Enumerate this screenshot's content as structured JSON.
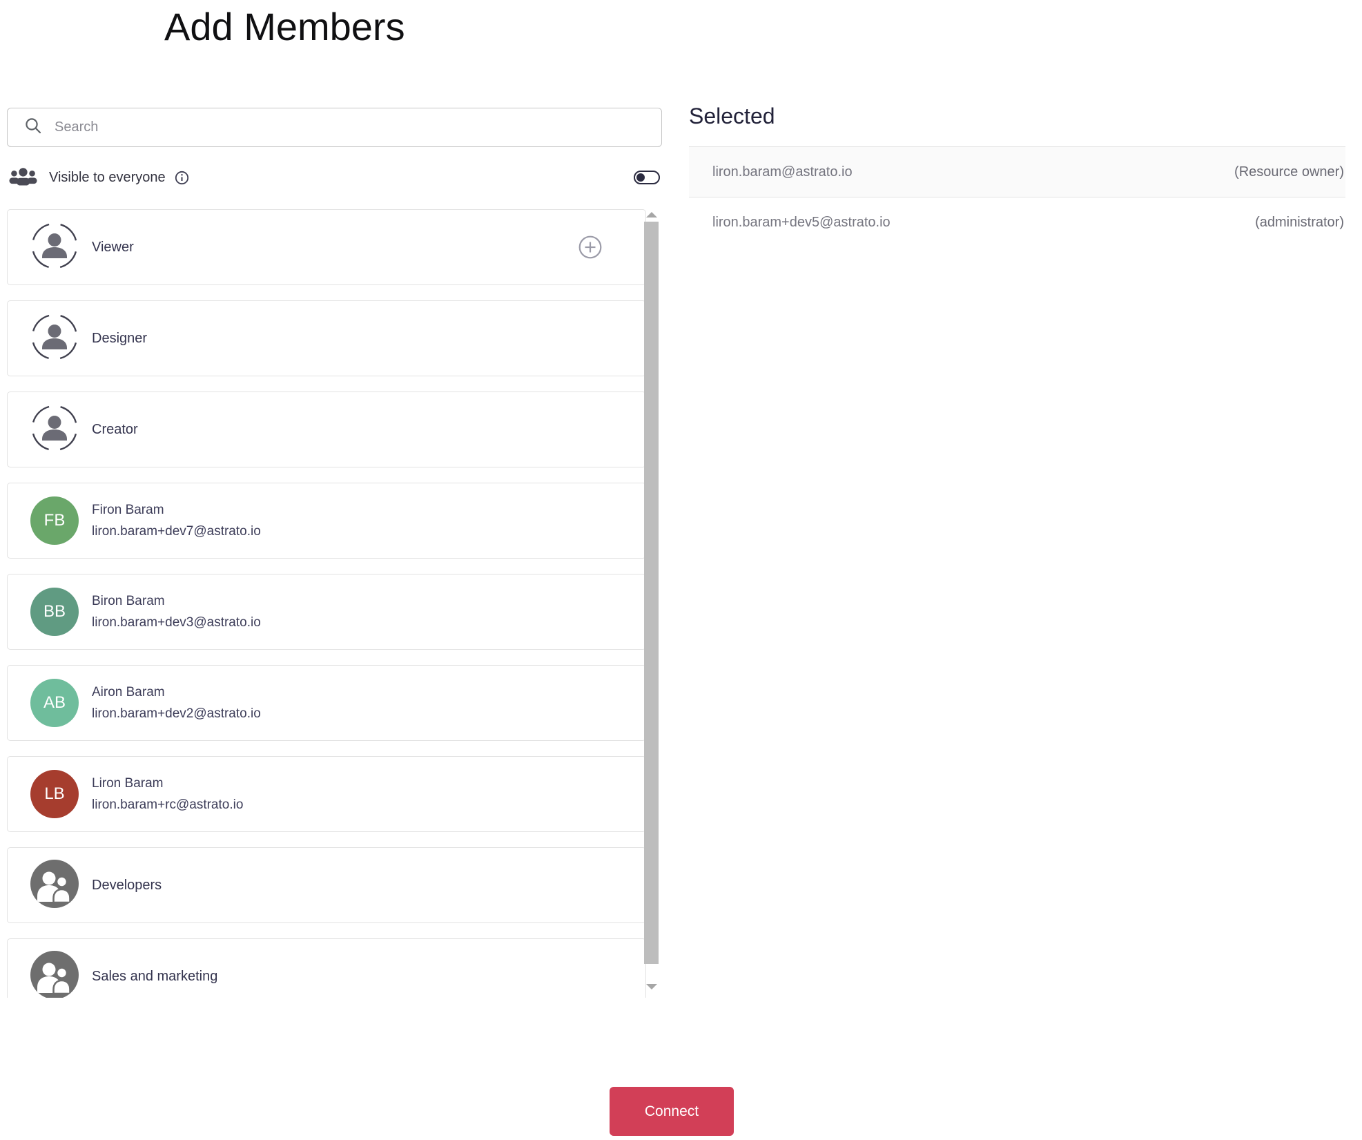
{
  "page": {
    "title": "Add Members"
  },
  "search": {
    "placeholder": "Search",
    "value": ""
  },
  "visibility": {
    "label": "Visible to everyone",
    "toggle_on": false
  },
  "member_list": [
    {
      "type": "role",
      "label": "Viewer",
      "has_add_button": true
    },
    {
      "type": "role",
      "label": "Designer"
    },
    {
      "type": "role",
      "label": "Creator"
    },
    {
      "type": "user",
      "initials": "FB",
      "name": "Firon Baram",
      "email": "liron.baram+dev7@astrato.io",
      "avatar_color": "#6aa76a"
    },
    {
      "type": "user",
      "initials": "BB",
      "name": "Biron Baram",
      "email": "liron.baram+dev3@astrato.io",
      "avatar_color": "#609b82"
    },
    {
      "type": "user",
      "initials": "AB",
      "name": "Airon Baram",
      "email": "liron.baram+dev2@astrato.io",
      "avatar_color": "#6fbd9c"
    },
    {
      "type": "user",
      "initials": "LB",
      "name": "Liron Baram",
      "email": "liron.baram+rc@astrato.io",
      "avatar_color": "#a63d2e"
    },
    {
      "type": "group",
      "label": "Developers"
    },
    {
      "type": "group",
      "label": "Sales and marketing"
    }
  ],
  "selected": {
    "heading": "Selected",
    "rows": [
      {
        "email": "liron.baram@astrato.io",
        "role": "(Resource owner)"
      },
      {
        "email": "liron.baram+dev5@astrato.io",
        "role": "(administrator)"
      }
    ]
  },
  "footer": {
    "connect_label": "Connect"
  },
  "colors": {
    "accent": "#d23f57",
    "toggle": "#2b2b40",
    "group_icon": "#6e6e6e",
    "role_icon": "#6b6b75",
    "border": "#e2e2e2"
  },
  "icons": [
    "search-icon",
    "groups-icon",
    "info-icon",
    "toggle-off",
    "role-person-icon",
    "add-plus-icon",
    "group-avatar-icon",
    "scroll-up-icon",
    "scroll-down-icon"
  ]
}
